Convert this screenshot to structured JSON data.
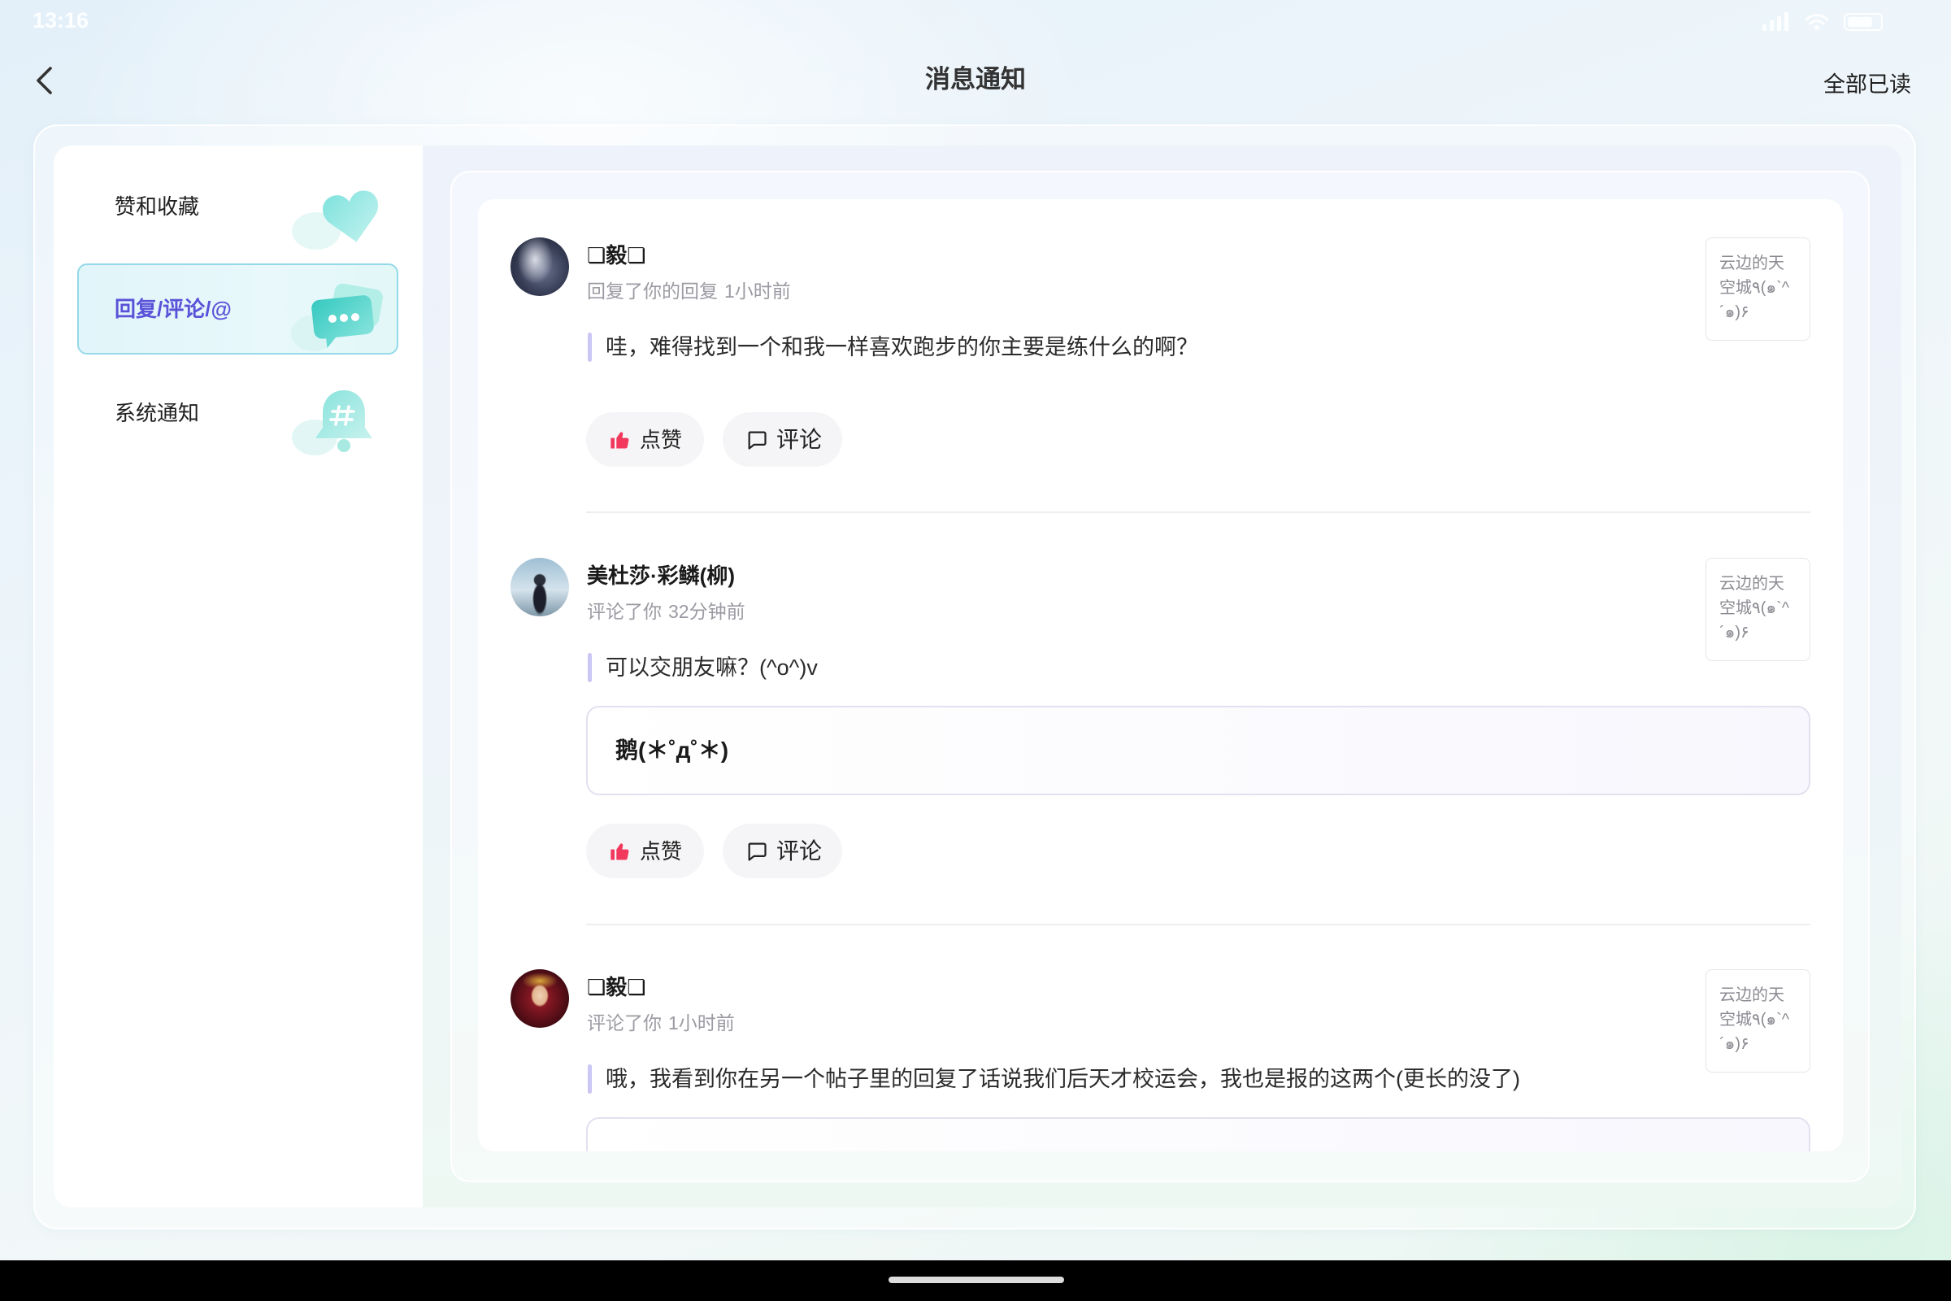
{
  "status_bar": {
    "time": "13:16",
    "icons": [
      "signal-icon",
      "wifi-icon",
      "battery-icon"
    ]
  },
  "header": {
    "back_icon": "chevron-left-icon",
    "title": "消息通知",
    "mark_all_read": "全部已读"
  },
  "sidebar": {
    "items": [
      {
        "label": "赞和收藏",
        "icon": "heart-icon",
        "selected": false
      },
      {
        "label": "回复/评论/@",
        "icon": "chat-bubbles-icon",
        "selected": true
      },
      {
        "label": "系统通知",
        "icon": "bell-icon",
        "selected": false
      }
    ]
  },
  "notifications": [
    {
      "user": "❏毅❏",
      "action": "回复了你的回复",
      "time": "1小时前",
      "content": "哇，难得找到一个和我一样喜欢跑步的你主要是练什么的啊？",
      "post_preview": "云边的天空城٩(๑`^´๑)۶",
      "like_label": "点赞",
      "comment_label": "评论"
    },
    {
      "user": "美杜莎·彩鳞(柳)",
      "action": "评论了你",
      "time": "32分钟前",
      "content": "可以交朋友嘛？(^o^)v",
      "quoted": "鹅(＊˚д˚＊)",
      "post_preview": "云边的天空城٩(๑`^´๑)۶",
      "like_label": "点赞",
      "comment_label": "评论"
    },
    {
      "user": "❏毅❏",
      "action": "评论了你",
      "time": "1小时前",
      "content": "哦，我看到你在另一个帖子里的回复了话说我们后天才校运会，我也是报的这两个(更长的没了)",
      "post_preview": "云边的天空城٩(๑`^´๑)۶"
    }
  ],
  "colors": {
    "accent": "#5a52d8",
    "like": "#f2385c",
    "selected_border": "#93d9e8",
    "quote_bar": "#cbc6f4"
  }
}
